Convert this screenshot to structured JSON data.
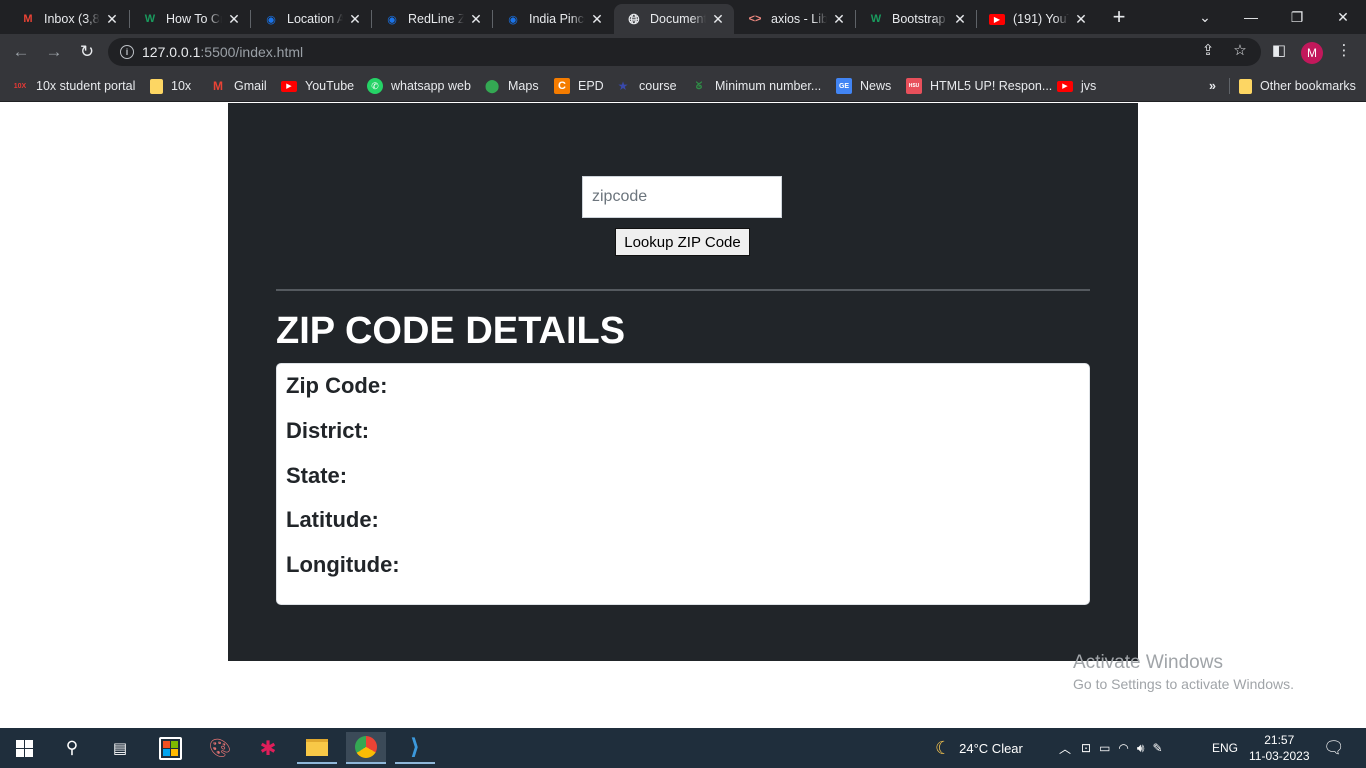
{
  "browser": {
    "tabs": [
      {
        "label": "Inbox (3,88",
        "icon": "gmail-icon",
        "color": "#ea4335"
      },
      {
        "label": "How To Cr",
        "icon": "w-icon",
        "color": "#1a9b5e"
      },
      {
        "label": "Location A",
        "icon": "redline-icon",
        "color": "#1a73e8"
      },
      {
        "label": "RedLine Zi",
        "icon": "redline-icon",
        "color": "#1a73e8"
      },
      {
        "label": "India Pinco",
        "icon": "redline-icon",
        "color": "#1a73e8"
      },
      {
        "label": "Document",
        "icon": "globe-icon",
        "color": "#e8eaed"
      },
      {
        "label": "axios - Libr",
        "icon": "code-icon",
        "color": "#f28b82"
      },
      {
        "label": "Bootstrap",
        "icon": "w-icon",
        "color": "#1a9b5e"
      },
      {
        "label": "(191) YouT",
        "icon": "youtube-icon",
        "color": "#ff0000"
      }
    ],
    "url_host": "127.0.0.1",
    "url_path": ":5500/index.html",
    "profile_initial": "M",
    "bookmarks": [
      {
        "label": "10x student portal",
        "icon": "10x-icon",
        "color": "#e53935"
      },
      {
        "label": "10x",
        "icon": "folder-icon",
        "color": "#fdd663"
      },
      {
        "label": "Gmail",
        "icon": "gmail-icon",
        "color": "#ea4335"
      },
      {
        "label": "YouTube",
        "icon": "youtube-icon",
        "color": "#ff0000"
      },
      {
        "label": "whatsapp web",
        "icon": "whatsapp-icon",
        "color": "#25d366"
      },
      {
        "label": "Maps",
        "icon": "maps-icon",
        "color": "#34a853"
      },
      {
        "label": "EPD",
        "icon": "c-icon",
        "color": "#f57c00"
      },
      {
        "label": "course",
        "icon": "star-icon",
        "color": "#1a237e"
      },
      {
        "label": "Minimum number...",
        "icon": "gfg-icon",
        "color": "#2f8d46"
      },
      {
        "label": "News",
        "icon": "news-icon",
        "color": "#4285f4"
      },
      {
        "label": "HTML5 UP! Respon...",
        "icon": "html5up-icon",
        "color": "#e8505b"
      },
      {
        "label": "jvs",
        "icon": "youtube-icon",
        "color": "#ff0000"
      }
    ],
    "more_bookmarks": "»",
    "other_bookmarks": "Other bookmarks"
  },
  "page": {
    "zip_placeholder": "zipcode",
    "lookup_button": "Lookup ZIP Code",
    "heading": "ZIP CODE DETAILS",
    "fields": [
      "Zip Code:",
      "District:",
      "State:",
      "Latitude:",
      "Longitude:"
    ]
  },
  "watermark": {
    "line1": "Activate Windows",
    "line2": "Go to Settings to activate Windows."
  },
  "taskbar": {
    "weather": "24°C  Clear",
    "language": "ENG",
    "time": "21:57",
    "date": "11-03-2023"
  }
}
